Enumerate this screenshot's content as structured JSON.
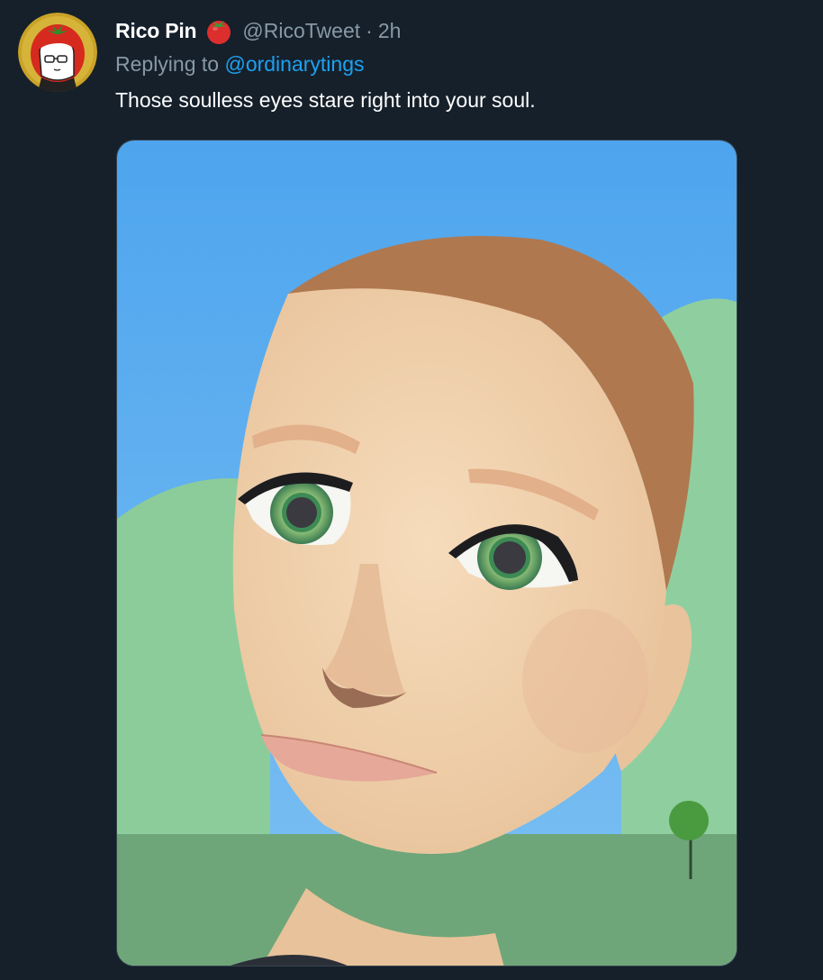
{
  "tweet": {
    "display_name": "Rico Pin",
    "badge_icon": "tomato-icon",
    "handle": "@RicoTweet",
    "separator": "·",
    "timestamp": "2h",
    "replying_prefix": "Replying to ",
    "replying_to": "@ordinarytings",
    "text": "Those soulless eyes stare right into your soul.",
    "avatar_icon": "cartoon-face-avatar",
    "media": "3d-avatar-face-image"
  },
  "colors": {
    "background": "#15202b",
    "secondary_text": "#8899a6",
    "link": "#1da1f2",
    "primary_text": "#ffffff"
  }
}
